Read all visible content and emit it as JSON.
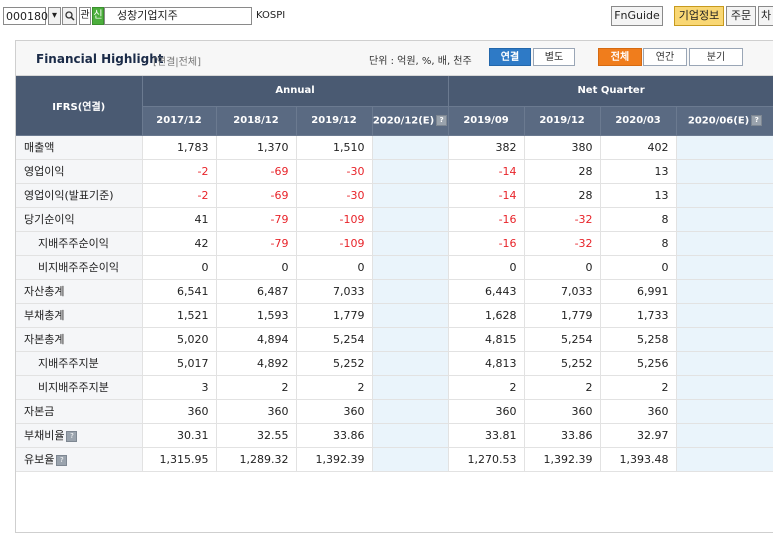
{
  "toolbar": {
    "stock_code": "000180",
    "dropdown_icon": "chevron-down-icon",
    "search_icon": "search-icon",
    "interest_label": "관",
    "new_label": "신",
    "company_name": "성창기업지주",
    "market": "KOSPI",
    "fnguide_label": "FnGuide",
    "company_info_label": "기업정보",
    "order_label": "주문",
    "more_label": "차"
  },
  "panel": {
    "title": "Financial Highlight",
    "subtitle": "[연결|전체]",
    "unit_text": "단위 : 억원, %, 배, 천주",
    "basis_options": [
      "연결",
      "별도"
    ],
    "basis_selected": "연결",
    "period_options": [
      "전체",
      "연간",
      "분기"
    ],
    "period_selected": "전체"
  },
  "table": {
    "corner_header": "IFRS(연결)",
    "group_headers": [
      "Annual",
      "Net Quarter"
    ],
    "columns": [
      "2017/12",
      "2018/12",
      "2019/12",
      "2020/12(E)",
      "2019/09",
      "2019/12",
      "2020/03",
      "2020/06(E)"
    ],
    "rows": [
      {
        "label": "매출액",
        "indent": false,
        "values": [
          "1,783",
          "1,370",
          "1,510",
          "",
          "382",
          "380",
          "402",
          ""
        ]
      },
      {
        "label": "영업이익",
        "indent": false,
        "values": [
          "-2",
          "-69",
          "-30",
          "",
          "-14",
          "28",
          "13",
          ""
        ]
      },
      {
        "label": "영업이익(발표기준)",
        "indent": false,
        "values": [
          "-2",
          "-69",
          "-30",
          "",
          "-14",
          "28",
          "13",
          ""
        ]
      },
      {
        "label": "당기순이익",
        "indent": false,
        "values": [
          "41",
          "-79",
          "-109",
          "",
          "-16",
          "-32",
          "8",
          ""
        ]
      },
      {
        "label": "지배주주순이익",
        "indent": true,
        "values": [
          "42",
          "-79",
          "-109",
          "",
          "-16",
          "-32",
          "8",
          ""
        ]
      },
      {
        "label": "비지배주주순이익",
        "indent": true,
        "values": [
          "0",
          "0",
          "0",
          "",
          "0",
          "0",
          "0",
          ""
        ]
      },
      {
        "label": "자산총계",
        "indent": false,
        "values": [
          "6,541",
          "6,487",
          "7,033",
          "",
          "6,443",
          "7,033",
          "6,991",
          ""
        ]
      },
      {
        "label": "부채총계",
        "indent": false,
        "values": [
          "1,521",
          "1,593",
          "1,779",
          "",
          "1,628",
          "1,779",
          "1,733",
          ""
        ]
      },
      {
        "label": "자본총계",
        "indent": false,
        "values": [
          "5,020",
          "4,894",
          "5,254",
          "",
          "4,815",
          "5,254",
          "5,258",
          ""
        ]
      },
      {
        "label": "지배주주지분",
        "indent": true,
        "values": [
          "5,017",
          "4,892",
          "5,252",
          "",
          "4,813",
          "5,252",
          "5,256",
          ""
        ]
      },
      {
        "label": "비지배주주지분",
        "indent": true,
        "values": [
          "3",
          "2",
          "2",
          "",
          "2",
          "2",
          "2",
          ""
        ]
      },
      {
        "label": "자본금",
        "indent": false,
        "values": [
          "360",
          "360",
          "360",
          "",
          "360",
          "360",
          "360",
          ""
        ]
      },
      {
        "label": "부채비율",
        "indent": false,
        "has_info": true,
        "values": [
          "30.31",
          "32.55",
          "33.86",
          "",
          "33.81",
          "33.86",
          "32.97",
          ""
        ]
      },
      {
        "label": "유보율",
        "indent": false,
        "has_info": true,
        "values": [
          "1,315.95",
          "1,289.32",
          "1,392.39",
          "",
          "1,270.53",
          "1,392.39",
          "1,393.48",
          ""
        ]
      }
    ]
  },
  "colors": {
    "header_bg": "#4a5a72",
    "negative": "#e8242a",
    "estimate_bg": "#eaf4fb",
    "active_blue": "#2e7ac6",
    "active_orange": "#f07d1c"
  }
}
